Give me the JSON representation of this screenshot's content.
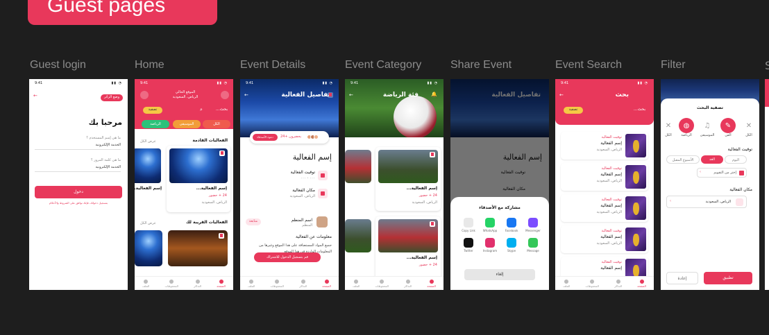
{
  "section_title": "Guest pages",
  "frames": [
    {
      "label": "Guest login"
    },
    {
      "label": "Home"
    },
    {
      "label": "Event Details"
    },
    {
      "label": "Event Category"
    },
    {
      "label": "Share Event"
    },
    {
      "label": "Event Search"
    },
    {
      "label": "Filter"
    },
    {
      "label": "S"
    }
  ],
  "status_time": "9:41",
  "login": {
    "guest_chip": "وضع الزائر",
    "title": "مرحبا بك",
    "field1_label": "ما هي إسم المستخدم ؟",
    "field1_value": "الخدمة الإلكترونية",
    "field2_label": "ما هي كلمة المرور ؟",
    "field2_value": "الخدمة الإلكترونية",
    "login_button": "دخول",
    "terms_text": "بتسجيل دخولك، فإنك توافق على الشروط والأحكام"
  },
  "home": {
    "location_label": "الموقع الحالي",
    "location_value": "الرياض، السعودية",
    "search_placeholder": "بحث...",
    "filter_chip": "تصفية",
    "categories": [
      "الكل",
      "الموسيقى",
      "الرياضة"
    ],
    "upcoming_title": "الفعاليات القادمة",
    "see_all": "عرض الكل",
    "card_title": "إسم الفعالية...",
    "card_date": "24 + حضور",
    "card_location": "الرياض، السعودية",
    "nearby_title": "الفعاليات القريبة لك",
    "nav": [
      "الصفحة",
      "التذاكر",
      "المحفوظات",
      "الملف"
    ]
  },
  "details": {
    "header_title": "تفاصيل الفعالية",
    "going": "24+ يحضرون",
    "invite": "دعوة الأصدقاء",
    "event_name": "إسم الفعالية",
    "date_label": "توقيت الفعالية",
    "date_value": "٠٠٠ - ٠٠٠",
    "place_label": "مكان الفعالية",
    "place_value": "الرياض، السعودية",
    "organizer_name": "اسم المنظم",
    "organizer_role": "المنظم",
    "follow_chip": "متابعة",
    "about_title": "معلومات عن الفعالية",
    "about_text": "جميع المواد المستضافة على هذا الموقع وغيرها من المعلومات الواردة في هذا الموقع",
    "register_button": "قم بتسجيل الدخول للاشتراك"
  },
  "category": {
    "header_title": "فئة الرياضة",
    "card_title": "إسم الفعالية...",
    "card_date": "24 + حضور",
    "card_location": "الرياض، السعودية"
  },
  "share": {
    "sheet_title": "مشاركة مع الأصدقاء",
    "targets": [
      "Copy Link",
      "WhatsApp",
      "Facebook",
      "Messenger",
      "Twitter",
      "Instagram",
      "Skype",
      "Message"
    ],
    "cancel_button": "إلغاء",
    "colors": [
      "#9a9a9a",
      "#25d366",
      "#1877f2",
      "#7b4dff",
      "#111111",
      "#e1306c",
      "#00aff0",
      "#34c759"
    ]
  },
  "search": {
    "header_title": "بحث",
    "search_placeholder": "بحث...",
    "filter_chip": "تصفية",
    "result_time": "توقيت الفعالية",
    "result_name": "إسم الفعالية",
    "result_place": "الرياض، السعودية",
    "result_extra": "الرياض، السعودية"
  },
  "filter": {
    "sheet_title": "تصفية البحث",
    "categories": [
      "الكل",
      "الموسيقى",
      "الرياضة",
      "الفن",
      "الكل"
    ],
    "time_title": "توقيت الفعالية",
    "time_options": [
      "اليوم",
      "الغد",
      "الأسبوع المقبل"
    ],
    "calendar_option": "إختر من التقويم",
    "place_title": "مكان الفعالية",
    "place_value": "الرياض، السعودية",
    "reset_button": "إعادة",
    "apply_button": "تطبيق"
  },
  "accent": "#e8385b"
}
